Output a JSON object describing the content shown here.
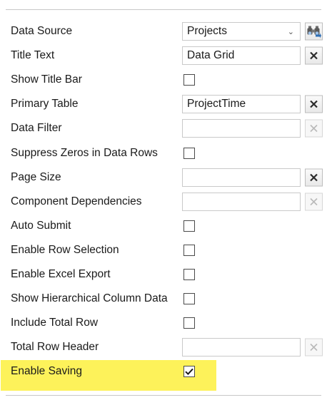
{
  "rows": [
    {
      "label": "Data Source",
      "value": "Projects"
    },
    {
      "label": "Title Text",
      "value": "Data Grid"
    },
    {
      "label": "Show Title Bar",
      "checked": false
    },
    {
      "label": "Primary Table",
      "value": "ProjectTime"
    },
    {
      "label": "Data Filter",
      "value": ""
    },
    {
      "label": "Suppress Zeros in Data Rows",
      "checked": false
    },
    {
      "label": "Page Size",
      "value": ""
    },
    {
      "label": "Component Dependencies",
      "value": ""
    },
    {
      "label": "Auto Submit",
      "checked": false
    },
    {
      "label": "Enable Row Selection",
      "checked": false
    },
    {
      "label": "Enable Excel Export",
      "checked": false
    },
    {
      "label": "Show Hierarchical Column Data",
      "checked": false
    },
    {
      "label": "Include Total Row",
      "checked": false
    },
    {
      "label": "Total Row Header",
      "value": ""
    },
    {
      "label": "Enable Saving",
      "checked": true
    }
  ],
  "colors": {
    "highlight": "#fdf25a",
    "clear_enabled": "#2b2b2b",
    "clear_disabled": "#b9b9b9",
    "binoculars_blue": "#2f6fb5"
  },
  "icons": {
    "browse": "binoculars-icon",
    "clear": "clear-x-icon",
    "dropdown": "chevron-down-icon",
    "check": "checkmark-icon"
  }
}
